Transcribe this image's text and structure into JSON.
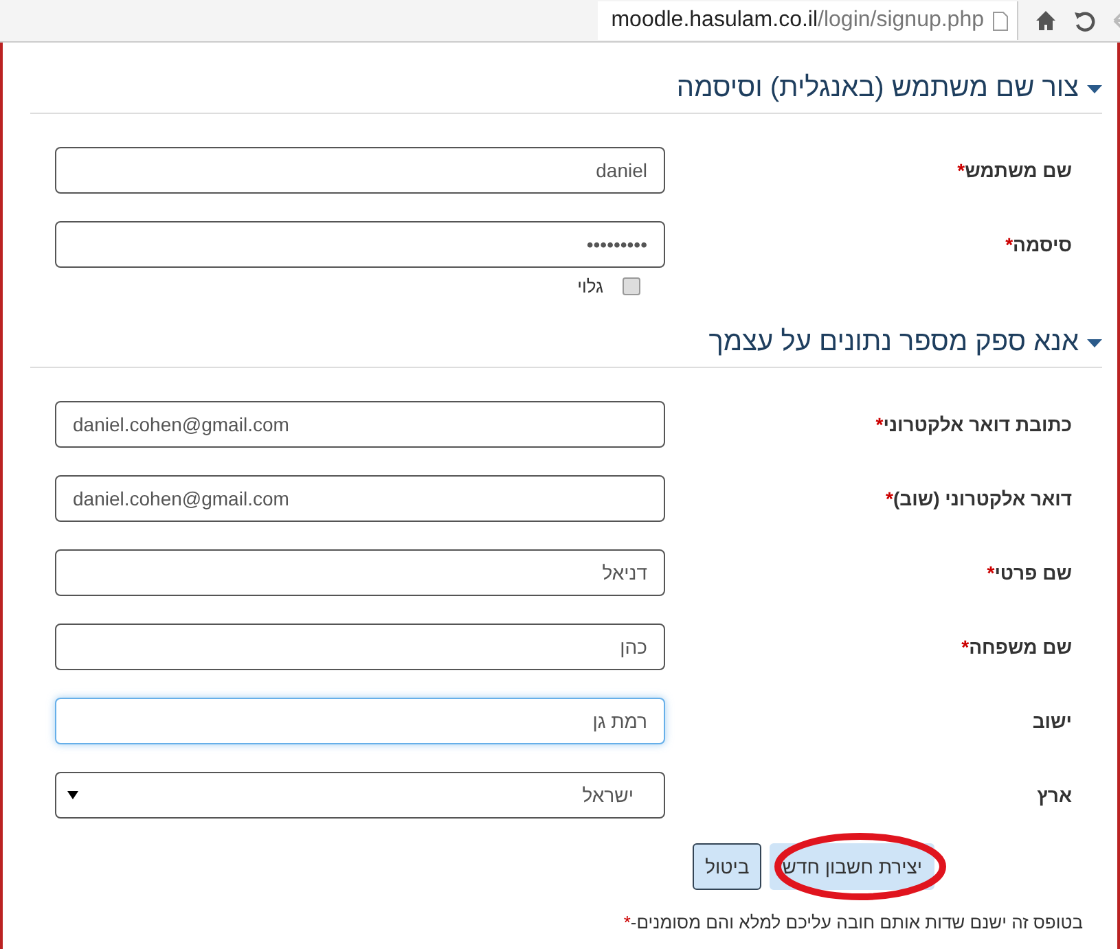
{
  "browser": {
    "url_host": "moodle.hasulam.co.il",
    "url_path": "/login/signup.php"
  },
  "sections": [
    {
      "title": "צור שם משתמש (באנגלית) וסיסמה",
      "expanded": true,
      "fields": [
        {
          "kind": "text",
          "label": "שם משתמש",
          "required_mark": "*",
          "value": "daniel",
          "focused": false
        },
        {
          "kind": "text",
          "label": "סיסמה",
          "required_mark": "*",
          "value": "•••••••••",
          "focused": false,
          "reveal": {
            "label": "גלוי",
            "checked": false
          }
        }
      ]
    },
    {
      "title": "אנא ספק מספר נתונים על עצמך",
      "expanded": true,
      "fields": [
        {
          "kind": "text",
          "label": "כתובת דואר אלקטרוני",
          "required_mark": "*",
          "value": "daniel.cohen@gmail.com",
          "focused": false,
          "left_aligned": true
        },
        {
          "kind": "text",
          "label": "דואר אלקטרוני (שוב)",
          "required_mark": "*",
          "value": "daniel.cohen@gmail.com",
          "focused": false,
          "left_aligned": true
        },
        {
          "kind": "text",
          "label": "שם פרטי",
          "required_mark": "*",
          "value": "דניאל",
          "focused": false
        },
        {
          "kind": "text",
          "label": "שם משפחה",
          "required_mark": "*",
          "value": "כהן",
          "focused": false
        },
        {
          "kind": "text",
          "label": "ישוב",
          "value": "רמת גן",
          "focused": true
        },
        {
          "kind": "select",
          "label": "ארץ",
          "value": "ישראל",
          "focused": false
        }
      ]
    }
  ],
  "buttons": [
    {
      "label": "יצירת חשבון חדש",
      "kind": "primary",
      "circled": true
    },
    {
      "label": "ביטול",
      "kind": "secondary",
      "circled": false
    }
  ],
  "footnote": {
    "text": "בטופס זה ישנם שדות אותם חובה עליכם למלא והם מסומנים-",
    "mark": "*"
  }
}
